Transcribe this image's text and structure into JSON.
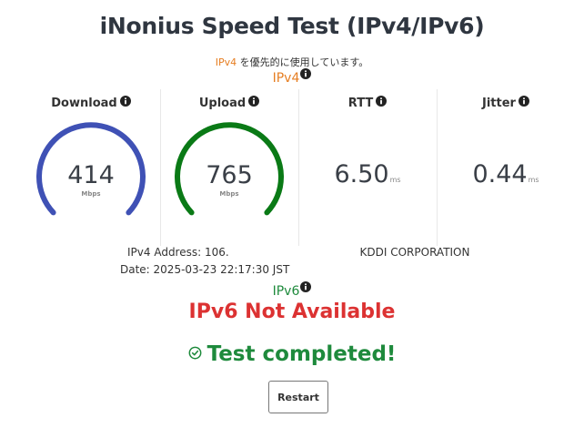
{
  "header": {
    "title": "iNonius Speed Test (IPv4/IPv6)",
    "preference_version": "IPv4",
    "preference_text": " を優先的に使用しています。"
  },
  "ipv4": {
    "section_label": "IPv4",
    "metrics": {
      "download": {
        "label": "Download",
        "value": "414",
        "unit": "Mbps",
        "color": "#3f51b5"
      },
      "upload": {
        "label": "Upload",
        "value": "765",
        "unit": "Mbps",
        "color": "#0a7a16"
      },
      "rtt": {
        "label": "RTT",
        "value": "6.50",
        "unit": "ms"
      },
      "jitter": {
        "label": "Jitter",
        "value": "0.44",
        "unit": "ms"
      }
    },
    "address_line": "IPv4 Address: 106.",
    "date_line": "Date: 2025-03-23 22:17:30 JST",
    "isp": "KDDI CORPORATION"
  },
  "ipv6": {
    "section_label": "IPv6",
    "status": "IPv6 Not Available"
  },
  "result": {
    "status": "Test completed!",
    "status_icon": "check-circle-icon"
  },
  "actions": {
    "restart_label": "Restart"
  },
  "colors": {
    "ipv4_accent": "#e67e22",
    "ipv6_accent": "#1e8a3c",
    "error": "#dc3232",
    "success": "#1e8a3c"
  }
}
